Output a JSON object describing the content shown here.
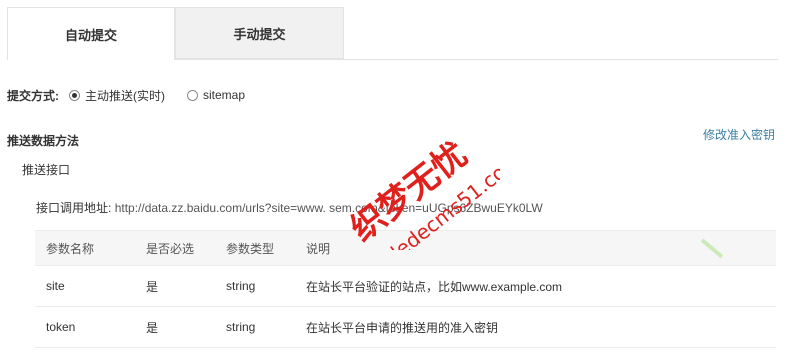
{
  "tabs": [
    {
      "label": "自动提交",
      "active": true
    },
    {
      "label": "手动提交",
      "active": false
    }
  ],
  "submit_method": {
    "label": "提交方式:",
    "options": [
      {
        "label": "主动推送(实时)",
        "checked": true
      },
      {
        "label": "sitemap",
        "checked": false
      }
    ]
  },
  "push_section": {
    "title": "推送数据方法",
    "edit_link": "修改准入密钥",
    "subtitle": "推送接口",
    "api_label": "接口调用地址:",
    "api_url": "http://data.zz.baidu.com/urls?site=www.       sem.com&token=uUGps6ZBwuEYk0LW"
  },
  "params_table": {
    "headers": [
      "参数名称",
      "是否必选",
      "参数类型",
      "说明"
    ],
    "rows": [
      [
        "site",
        "是",
        "string",
        "在站长平台验证的站点，比如www.example.com"
      ],
      [
        "token",
        "是",
        "string",
        "在站长平台申请的推送用的准入密钥"
      ]
    ]
  },
  "watermark": {
    "line1": "织梦无忧",
    "line2": "dedecms51.com",
    "color": "#e0201c"
  },
  "colors": {
    "link": "#3b7fa6",
    "tab_inactive_bg": "#f1f1f1",
    "table_header_bg": "#f6f6f6"
  }
}
